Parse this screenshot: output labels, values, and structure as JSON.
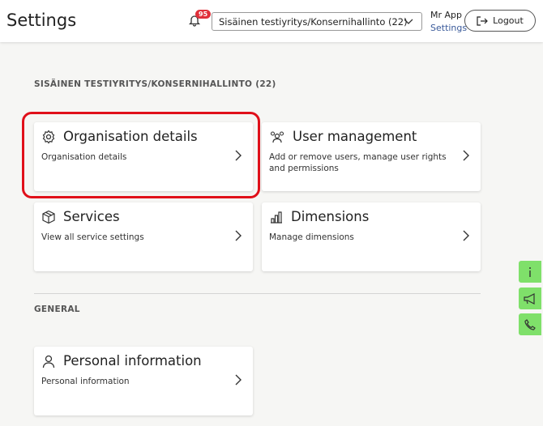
{
  "header": {
    "title": "Settings",
    "notification_count": "95",
    "org_select": "Sisäinen testiyritys/Konsernihallinto (22)",
    "user_name": "Mr App",
    "settings_link": "Settings",
    "logout_label": "Logout"
  },
  "org_section": {
    "label": "SISÄINEN TESTIYRITYS/KONSERNIHALLINTO (22)",
    "cards": [
      {
        "title": "Organisation details",
        "desc": "Organisation details",
        "icon": "gear-icon"
      },
      {
        "title": "User management",
        "desc": "Add or remove users, manage user rights and permissions",
        "icon": "users-icon"
      },
      {
        "title": "Services",
        "desc": "View all service settings",
        "icon": "box-icon"
      },
      {
        "title": "Dimensions",
        "desc": "Manage dimensions",
        "icon": "bar-chart-icon"
      }
    ]
  },
  "general_section": {
    "label": "GENERAL",
    "cards": [
      {
        "title": "Personal information",
        "desc": "Personal information",
        "icon": "person-icon"
      }
    ]
  },
  "side_buttons": [
    "info-icon",
    "megaphone-icon",
    "phone-icon"
  ],
  "colors": {
    "highlight": "#e0101a",
    "side_button": "#7fe06a",
    "badge": "#e0303a"
  }
}
